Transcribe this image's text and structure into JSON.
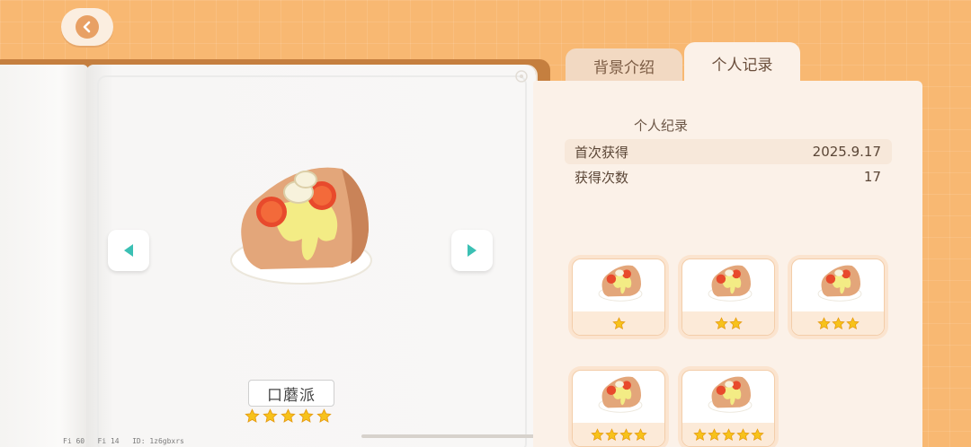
{
  "tabs": [
    {
      "label": "背景介绍",
      "active": false
    },
    {
      "label": "个人记录",
      "active": true
    }
  ],
  "record": {
    "title": "个人纪录",
    "rows": [
      {
        "label": "首次获得",
        "value": "2025.9.17"
      },
      {
        "label": "获得次数",
        "value": "17"
      }
    ]
  },
  "item": {
    "name": "口蘑派",
    "stars": 5
  },
  "variants": [
    {
      "stars": 1
    },
    {
      "stars": 2
    },
    {
      "stars": 3
    },
    {
      "stars": 4
    },
    {
      "stars": 5
    }
  ],
  "debug": "Fi 60   Fi 14   ID: 1z6gbxrs",
  "icons": {
    "back": "back-arrow-icon",
    "prev": "left-arrow-icon",
    "next": "right-arrow-icon",
    "star": "star-icon"
  },
  "colors": {
    "background": "#f8b872",
    "accent_teal": "#3bc0b4",
    "star_gold": "#f7c21b",
    "panel": "#fbf1e8"
  }
}
